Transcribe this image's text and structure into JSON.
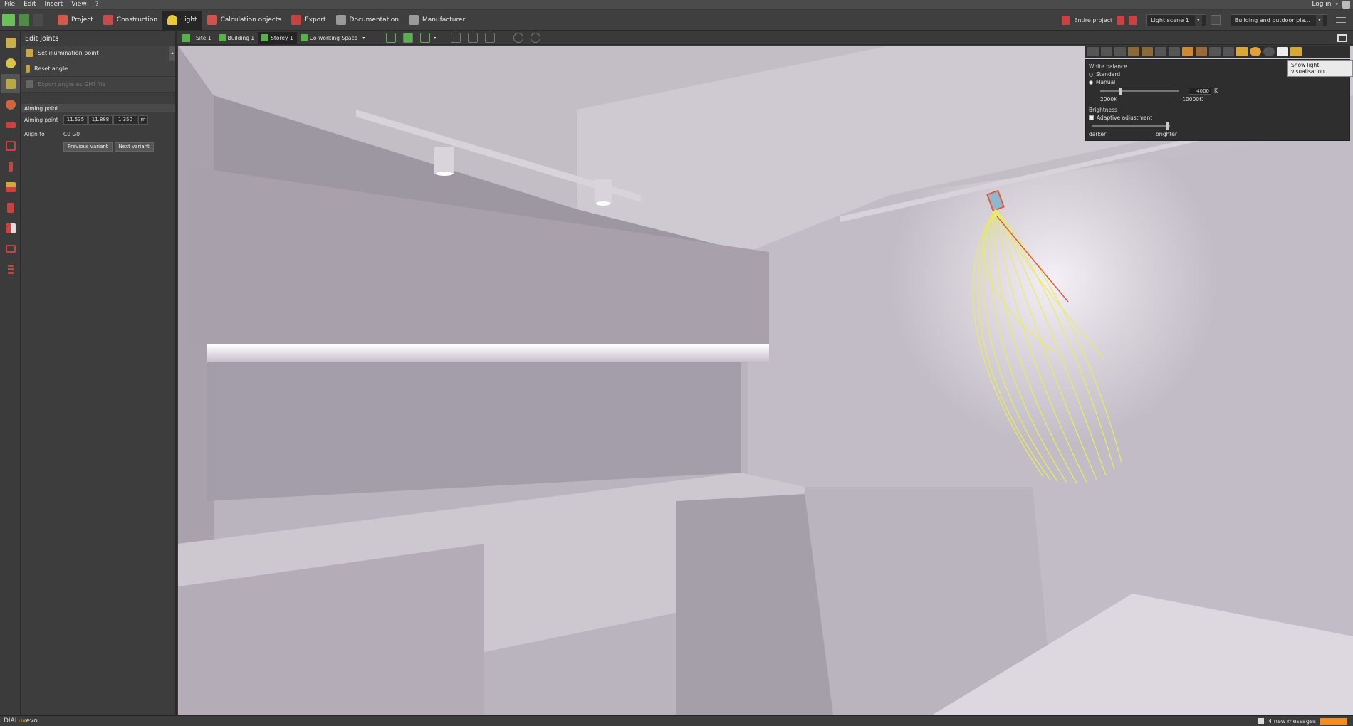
{
  "menu": {
    "items": [
      "File",
      "Edit",
      "Insert",
      "View",
      "?"
    ],
    "login": "Log in"
  },
  "toolbar": {
    "tabs": [
      {
        "label": "Project",
        "color": "#d35a4a"
      },
      {
        "label": "Construction",
        "color": "#c94a4a"
      },
      {
        "label": "Light",
        "color": "#e8c93a"
      },
      {
        "label": "Calculation objects",
        "color": "#d0524a"
      },
      {
        "label": "Export",
        "color": "#c84242"
      },
      {
        "label": "Documentation",
        "color": "#9a9a9a"
      },
      {
        "label": "Manufacturer",
        "color": "#9a9a9a"
      }
    ],
    "active_tab": "Light",
    "entire_project": "Entire project",
    "light_scene": "Light scene 1",
    "planning_mode": "Building and outdoor pla..."
  },
  "panel": {
    "title": "Edit joints",
    "rows": [
      {
        "label": "Set illumination point",
        "disabled": false
      },
      {
        "label": "Reset angle",
        "disabled": false
      },
      {
        "label": "Export angle as GMI file",
        "disabled": true
      }
    ],
    "section": "Aiming point",
    "aiming_point_label": "Aiming point",
    "aiming_values": [
      "11.535",
      "11.888",
      "1.350"
    ],
    "aiming_unit": "m",
    "align_to_label": "Align to",
    "align_to_value": "C0  G0",
    "prev_button": "Previous variant",
    "next_button": "Next variant"
  },
  "viewbar": {
    "crumbs": [
      "Site 1",
      "Building 1",
      "Storey 1",
      "Co-working Space"
    ],
    "active_crumb": "Storey 1"
  },
  "overlay": {
    "white_balance_title": "White balance",
    "opt_standard": "Standard",
    "opt_manual": "Manual",
    "manual_selected": true,
    "wb_value": "4000",
    "wb_unit": "K",
    "wb_fraction": 0.25,
    "wb_min": "2000K",
    "wb_max": "10000K",
    "brightness_title": "Brightness",
    "adaptive_label": "Adaptive adjustment",
    "adaptive_checked": true,
    "brightness_fraction": 0.98,
    "darker": "darker",
    "brighter": "brighter",
    "tooltip": "Show light visualisation"
  },
  "status": {
    "brand_prefix": "DIAL",
    "brand_lux": "ux",
    "brand_suffix": "evo",
    "messages": "4 new messages",
    "msg_color": "#f28c1e"
  }
}
